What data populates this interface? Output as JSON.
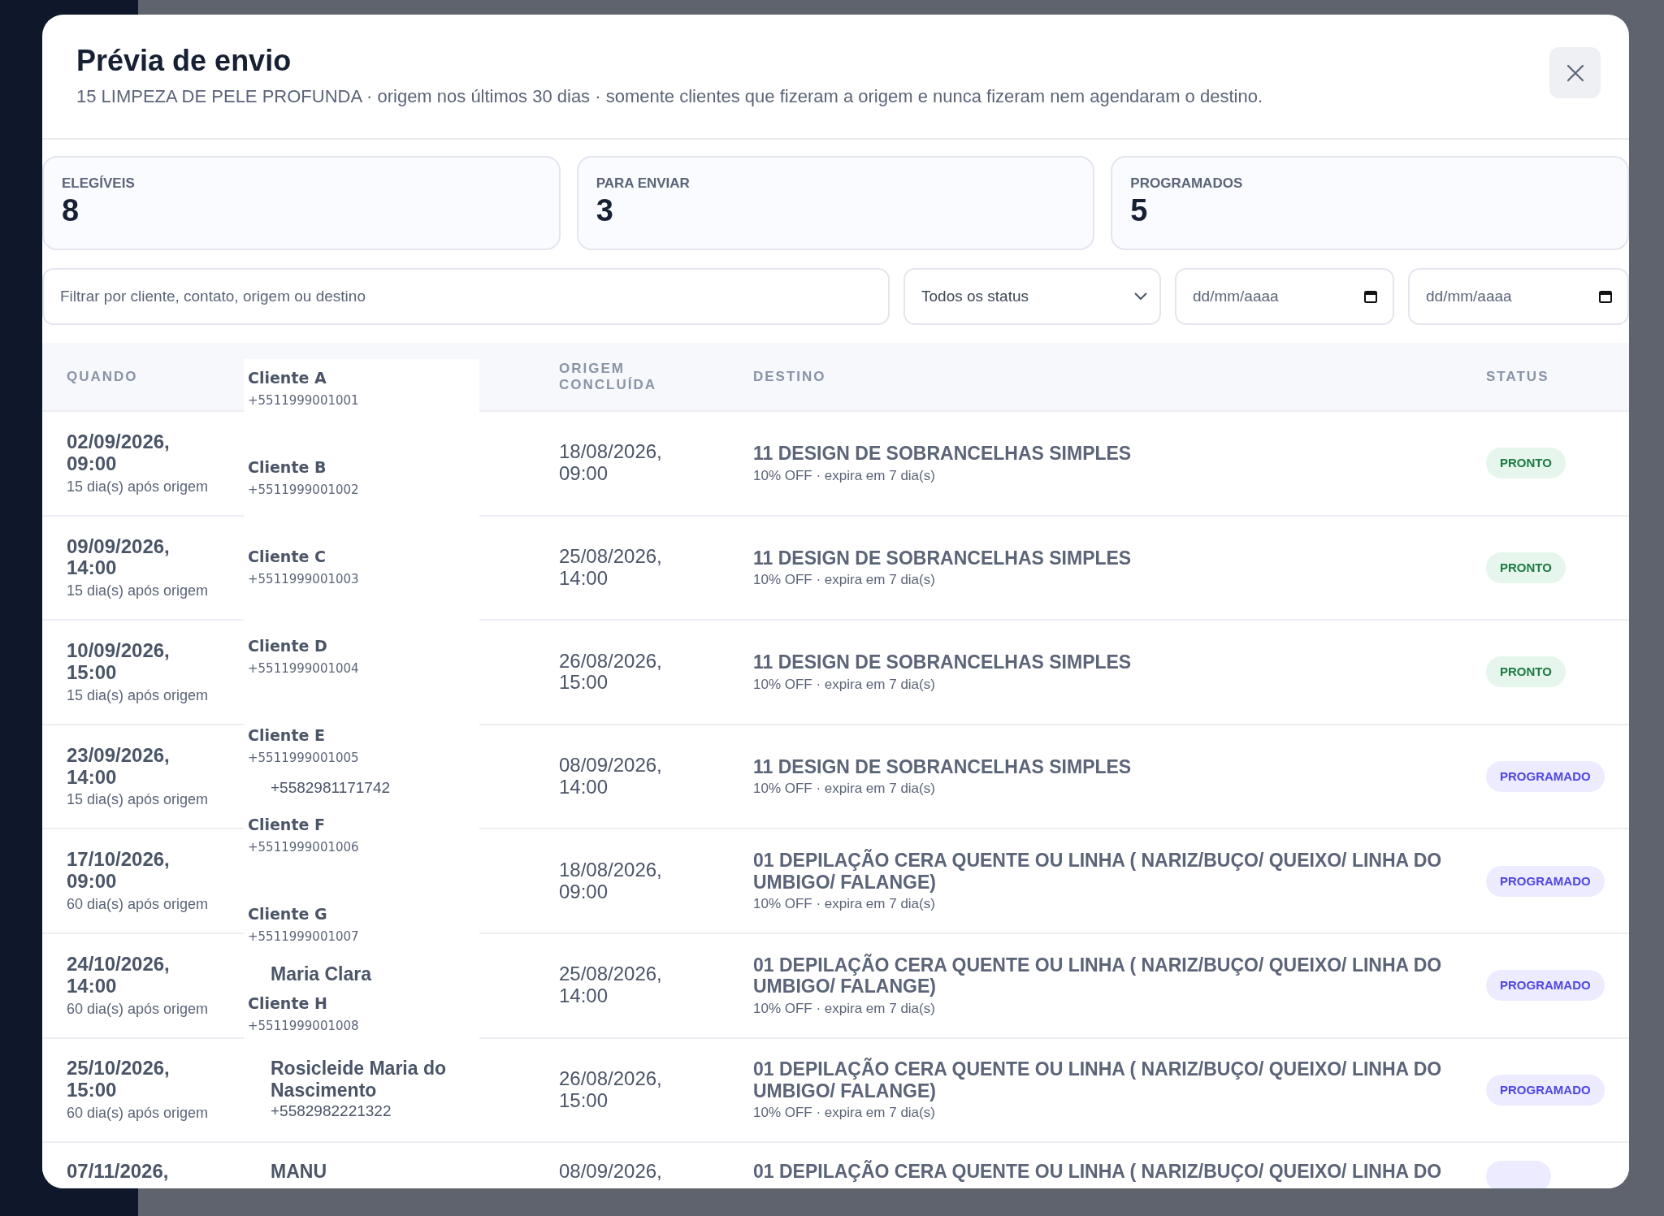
{
  "dialog": {
    "title": "Prévia de envio",
    "subtitle": "15 LIMPEZA DE PELE PROFUNDA · origem nos últimos 30 dias · somente clientes que fizeram a origem e nunca fizeram nem agendaram o destino."
  },
  "stats": [
    {
      "label": "ELEGÍVEIS",
      "value": "8"
    },
    {
      "label": "PARA ENVIAR",
      "value": "3"
    },
    {
      "label": "PROGRAMADOS",
      "value": "5"
    }
  ],
  "filters": {
    "search": {
      "placeholder": "Filtrar por cliente, contato, origem ou destino"
    },
    "status_select": {
      "value": "Todos os status"
    },
    "date_from": {
      "placeholder": "dd/mm/aaaa"
    },
    "date_to": {
      "placeholder": "dd/mm/aaaa"
    }
  },
  "table": {
    "columns": [
      {
        "label": "QUANDO"
      },
      {
        "label": "ORIGEM CONCLUÍDA"
      },
      {
        "label": "DESTINO"
      },
      {
        "label": "STATUS"
      }
    ],
    "rows": [
      {
        "when": "02/09/2026, 09:00",
        "offset": "15 dia(s) após origem",
        "origin": "18/08/2026, 09:00",
        "destination": "11 DESIGN DE SOBRANCELHAS SIMPLES",
        "offer": "10% OFF · expira em 7 dia(s)",
        "status": {
          "kind": "ready",
          "label": "PRONTO"
        }
      },
      {
        "when": "09/09/2026, 14:00",
        "offset": "15 dia(s) após origem",
        "origin": "25/08/2026, 14:00",
        "destination": "11 DESIGN DE SOBRANCELHAS SIMPLES",
        "offer": "10% OFF · expira em 7 dia(s)",
        "status": {
          "kind": "ready",
          "label": "PRONTO"
        }
      },
      {
        "when": "10/09/2026, 15:00",
        "offset": "15 dia(s) após origem",
        "origin": "26/08/2026, 15:00",
        "destination": "11 DESIGN DE SOBRANCELHAS SIMPLES",
        "offer": "10% OFF · expira em 7 dia(s)",
        "status": {
          "kind": "ready",
          "label": "PRONTO"
        }
      },
      {
        "when": "23/09/2026, 14:00",
        "offset": "15 dia(s) após origem",
        "client_phone": "+5582981171742",
        "origin": "08/09/2026, 14:00",
        "destination": "11 DESIGN DE SOBRANCELHAS SIMPLES",
        "offer": "10% OFF · expira em 7 dia(s)",
        "status": {
          "kind": "scheduled",
          "label": "PROGRAMADO"
        }
      },
      {
        "when": "17/10/2026, 09:00",
        "offset": "60 dia(s) após origem",
        "origin": "18/08/2026, 09:00",
        "destination": "01 DEPILAÇÃO CERA QUENTE OU LINHA ( NARIZ/BUÇO/ QUEIXO/ LINHA DO UMBIGO/ FALANGE)",
        "offer": "10% OFF · expira em 7 dia(s)",
        "status": {
          "kind": "scheduled",
          "label": "PROGRAMADO"
        }
      },
      {
        "when": "24/10/2026, 14:00",
        "offset": "60 dia(s) após origem",
        "client_name": "Maria Clara",
        "origin": "25/08/2026, 14:00",
        "destination": "01 DEPILAÇÃO CERA QUENTE OU LINHA ( NARIZ/BUÇO/ QUEIXO/ LINHA DO UMBIGO/ FALANGE)",
        "offer": "10% OFF · expira em 7 dia(s)",
        "status": {
          "kind": "scheduled",
          "label": "PROGRAMADO"
        }
      },
      {
        "when": "25/10/2026, 15:00",
        "offset": "60 dia(s) após origem",
        "client_name": "Rosicleide Maria do Nascimento",
        "client_phone": "+5582982221322",
        "origin": "26/08/2026, 15:00",
        "destination": "01 DEPILAÇÃO CERA QUENTE OU LINHA ( NARIZ/BUÇO/ QUEIXO/ LINHA DO UMBIGO/ FALANGE)",
        "offer": "10% OFF · expira em 7 dia(s)",
        "status": {
          "kind": "scheduled",
          "label": "PROGRAMADO"
        }
      },
      {
        "when": "07/11/2026,",
        "client_name": "MANU",
        "origin": "08/09/2026,",
        "destination": "01 DEPILAÇÃO CERA QUENTE OU LINHA ( NARIZ/BUÇO/ QUEIXO/ LINHA DO",
        "status": {
          "kind": "scheduled"
        }
      }
    ]
  },
  "client_overlay": [
    {
      "name": "Cliente A",
      "phone": "+5511999001001"
    },
    {
      "name": "Cliente B",
      "phone": "+5511999001002"
    },
    {
      "name": "Cliente C",
      "phone": "+5511999001003"
    },
    {
      "name": "Cliente D",
      "phone": "+5511999001004"
    },
    {
      "name": "Cliente E",
      "phone": "+5511999001005"
    },
    {
      "name": "Cliente F",
      "phone": "+5511999001006"
    },
    {
      "name": "Cliente G",
      "phone": "+5511999001007"
    },
    {
      "name": "Cliente H",
      "phone": "+5511999001008"
    }
  ]
}
